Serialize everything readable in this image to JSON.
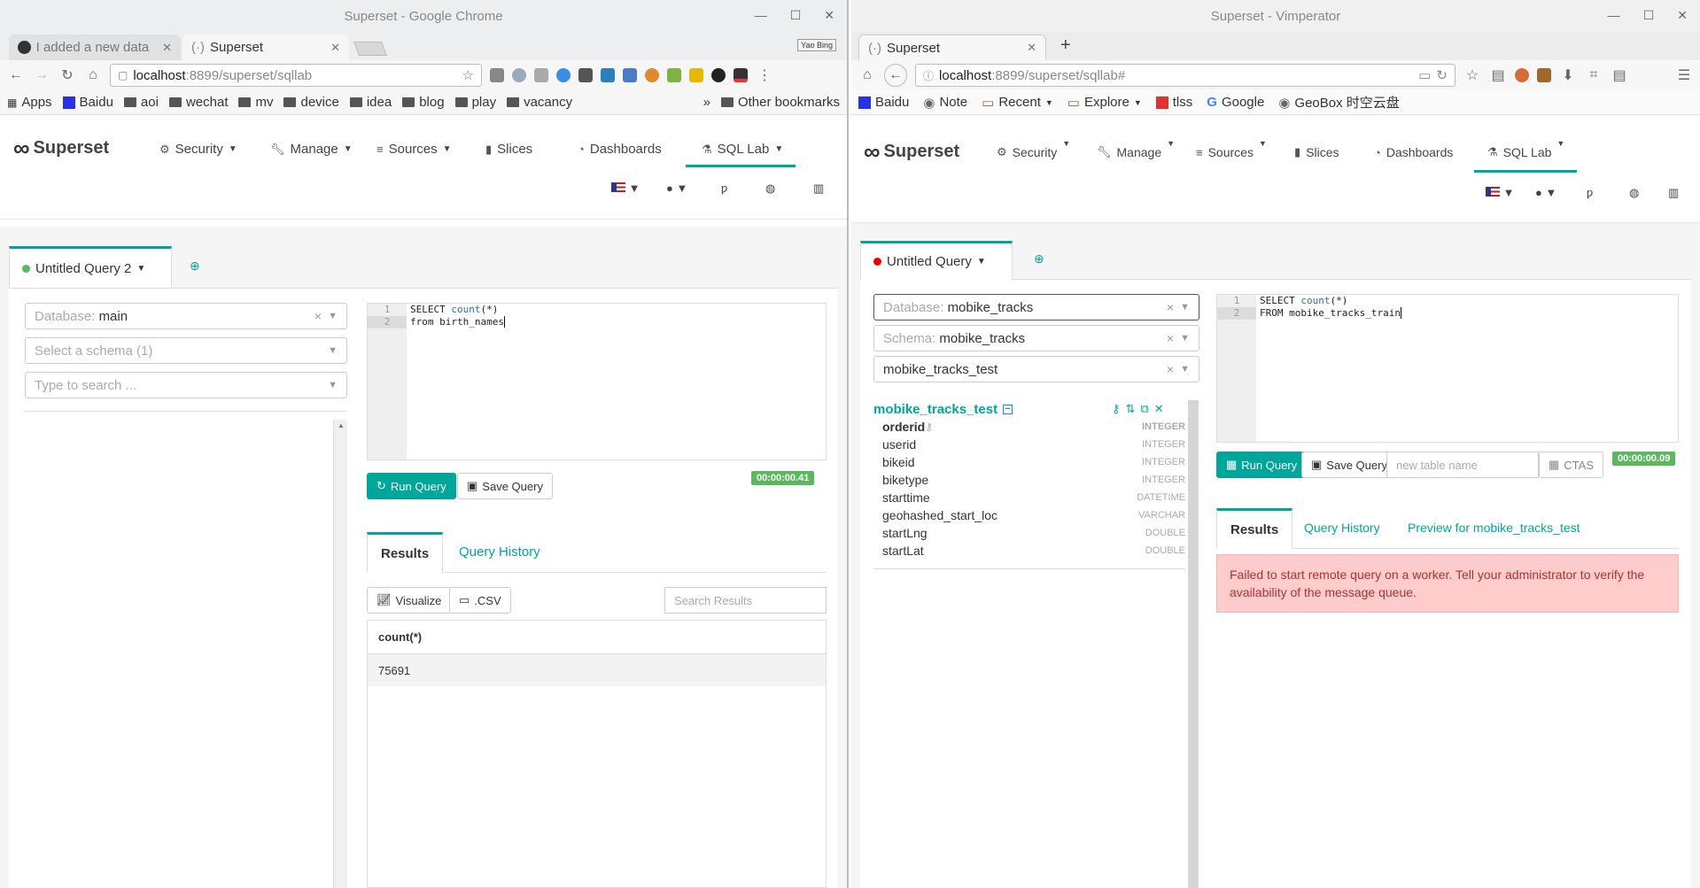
{
  "left": {
    "window_title": "Superset - Google Chrome",
    "tabs": [
      {
        "label": "I added a new data"
      },
      {
        "label": "Superset"
      }
    ],
    "profile_badge": "Yao Bing",
    "url_host": "localhost",
    "url_path": ":8899/superset/sqllab",
    "bookmarks": [
      "Apps",
      "Baidu",
      "aoi",
      "wechat",
      "mv",
      "device",
      "idea",
      "blog",
      "play",
      "vacancy"
    ],
    "bookmarks_more": "»",
    "other_bookmarks": "Other bookmarks",
    "brand": "Superset",
    "menu": {
      "security": "Security",
      "manage": "Manage",
      "sources": "Sources",
      "slices": "Slices",
      "dashboards": "Dashboards",
      "sqllab": "SQL Lab"
    },
    "query_tab": "Untitled Query 2",
    "database_label": "Database:",
    "database_value": "main",
    "schema_placeholder": "Select a schema (1)",
    "table_placeholder": "Type to search ...",
    "code": {
      "l1": "1",
      "l2": "2",
      "c1_kw1": "SELECT",
      "c1_kw2": "count",
      "c1_rest": "(*)",
      "c2": "from birth_names"
    },
    "run_query": "Run Query",
    "save_query": "Save Query",
    "timer": "00:00:00.41",
    "results_tab": "Results",
    "history_tab": "Query History",
    "visualize": "Visualize",
    "csv": ".CSV",
    "search_placeholder": "Search Results",
    "result_header": "count(*)",
    "result_value": "75691"
  },
  "right": {
    "window_title": "Superset - Vimperator",
    "tab": "Superset",
    "url_host": "localhost",
    "url_path": ":8899/superset/sqllab#",
    "bookmarks": [
      "Baidu",
      "Note",
      "Recent",
      "Explore",
      "tlss",
      "Google",
      "GeoBox 时空云盘"
    ],
    "brand": "Superset",
    "menu": {
      "security": "Security",
      "manage": "Manage",
      "sources": "Sources",
      "slices": "Slices",
      "dashboards": "Dashboards",
      "sqllab": "SQL Lab"
    },
    "query_tab": "Untitled Query",
    "database_label": "Database:",
    "database_value": "mobike_tracks",
    "schema_label": "Schema:",
    "schema_value": "mobike_tracks",
    "table_value": "mobike_tracks_test",
    "table_name": "mobike_tracks_test",
    "columns": [
      {
        "name": "orderid",
        "type": "INTEGER"
      },
      {
        "name": "userid",
        "type": "INTEGER"
      },
      {
        "name": "bikeid",
        "type": "INTEGER"
      },
      {
        "name": "biketype",
        "type": "INTEGER"
      },
      {
        "name": "starttime",
        "type": "DATETIME"
      },
      {
        "name": "geohashed_start_loc",
        "type": "VARCHAR"
      },
      {
        "name": "startLng",
        "type": "DOUBLE"
      },
      {
        "name": "startLat",
        "type": "DOUBLE"
      }
    ],
    "code": {
      "l1": "1",
      "l2": "2",
      "c1_kw1": "SELECT",
      "c1_kw2": "count",
      "c1_rest": "(*)",
      "c2": "FROM mobike_tracks_train"
    },
    "run_query": "Run Query",
    "save_query": "Save Query",
    "table_name_placeholder": "new table name",
    "ctas": "CTAS",
    "timer": "00:00:00.09",
    "results_tab": "Results",
    "history_tab": "Query History",
    "preview_tab": "Preview for mobike_tracks_test",
    "error": "Failed to start remote query on a worker. Tell your administrator to verify the availability of the message queue."
  }
}
